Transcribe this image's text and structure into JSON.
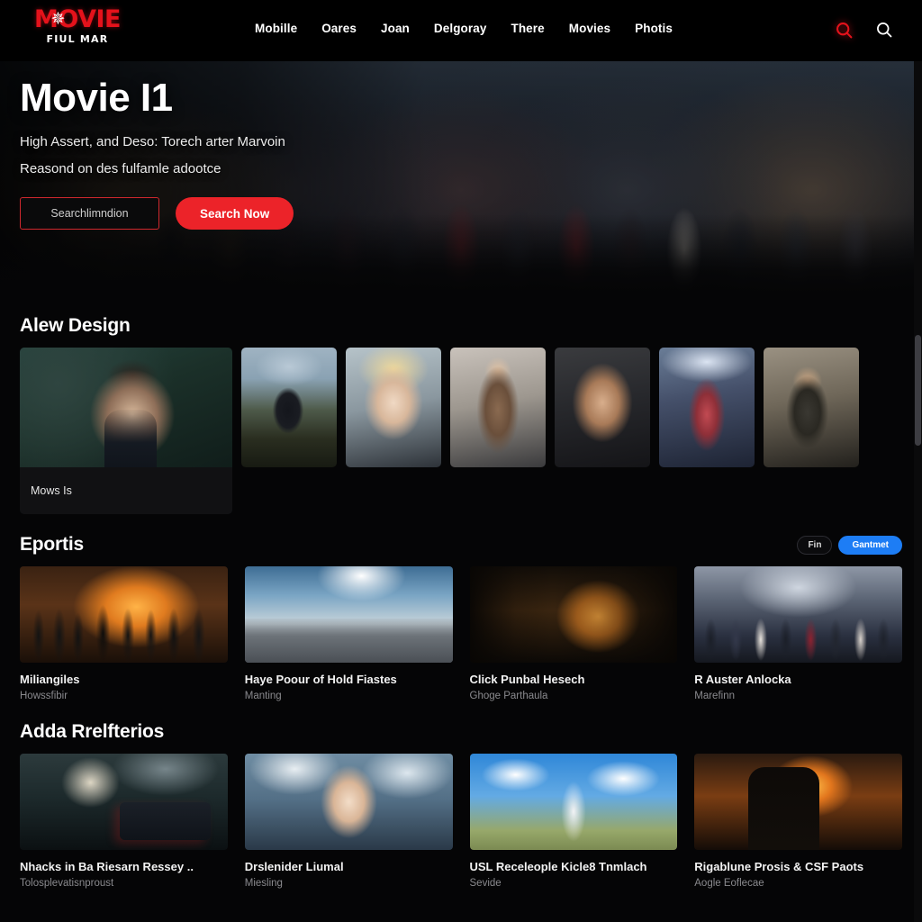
{
  "header": {
    "logo": {
      "main": "MOVIE",
      "sub": "FIUL MAR",
      "star_icon": "star-icon"
    },
    "nav": [
      {
        "label": "Mobille"
      },
      {
        "label": "Oares"
      },
      {
        "label": "Joan"
      },
      {
        "label": "Delgoray"
      },
      {
        "label": "There"
      },
      {
        "label": "Movies"
      },
      {
        "label": "Photis"
      }
    ],
    "actions": [
      {
        "icon": "search-icon-red",
        "color": "#e4121b"
      },
      {
        "icon": "search-icon-white",
        "color": "#ffffff"
      }
    ]
  },
  "hero": {
    "title": "Movie I1",
    "subtitle_line1": "High Assert, and Deso: Torech arter  Marvoin",
    "subtitle_line2": "Reasond on des fulfamle adootce",
    "search_placeholder": "Searchlimndion",
    "search_value": "",
    "cta_label": "Search Now"
  },
  "sections": [
    {
      "id": "alew-design",
      "title": "Alew Design",
      "feature": {
        "caption": "Mows Is"
      },
      "thumbs": [
        {
          "name": "thumb-figure-arms-out"
        },
        {
          "name": "thumb-blonde-woman"
        },
        {
          "name": "thumb-man-tank-top"
        },
        {
          "name": "thumb-brunette-woman"
        },
        {
          "name": "thumb-woman-red-shirt-crowd"
        },
        {
          "name": "thumb-man-suit-agents"
        }
      ]
    },
    {
      "id": "eportis",
      "title": "Eportis",
      "pills": [
        {
          "label": "Fin",
          "style": "ghost"
        },
        {
          "label": "Gantmet",
          "style": "solid",
          "color": "#1d7df5"
        }
      ],
      "cards": [
        {
          "title": "Miliangiles",
          "meta": "Howssfibir",
          "art": "art-a"
        },
        {
          "title": "Haye Poour of Hold Fiastes",
          "meta": "Manting",
          "art": "art-b"
        },
        {
          "title": "Click Punbal Hesech",
          "meta": "Ghoge Parthaula",
          "art": "art-c"
        },
        {
          "title": "R Auster Anlocka",
          "meta": "Marefinn",
          "art": "art-d"
        }
      ]
    },
    {
      "id": "adda-rrelfterios",
      "title": "Adda Rrelfterios",
      "cards": [
        {
          "title": "Nhacks in Ba Riesarn Ressey ..",
          "meta": "Tolosplevatisnproust",
          "art": "art-e"
        },
        {
          "title": "Drslenider Liumal",
          "meta": "Miesling",
          "art": "art-f"
        },
        {
          "title": "USL Receleople Kicle8 Tnmlach",
          "meta": "Sevide",
          "art": "art-g"
        },
        {
          "title": "Rigablune Prosis & CSF Paots",
          "meta": "Aogle Eoflecae",
          "art": "art-h"
        }
      ]
    }
  ],
  "scrollbar": {
    "name": "vertical-scrollbar"
  }
}
